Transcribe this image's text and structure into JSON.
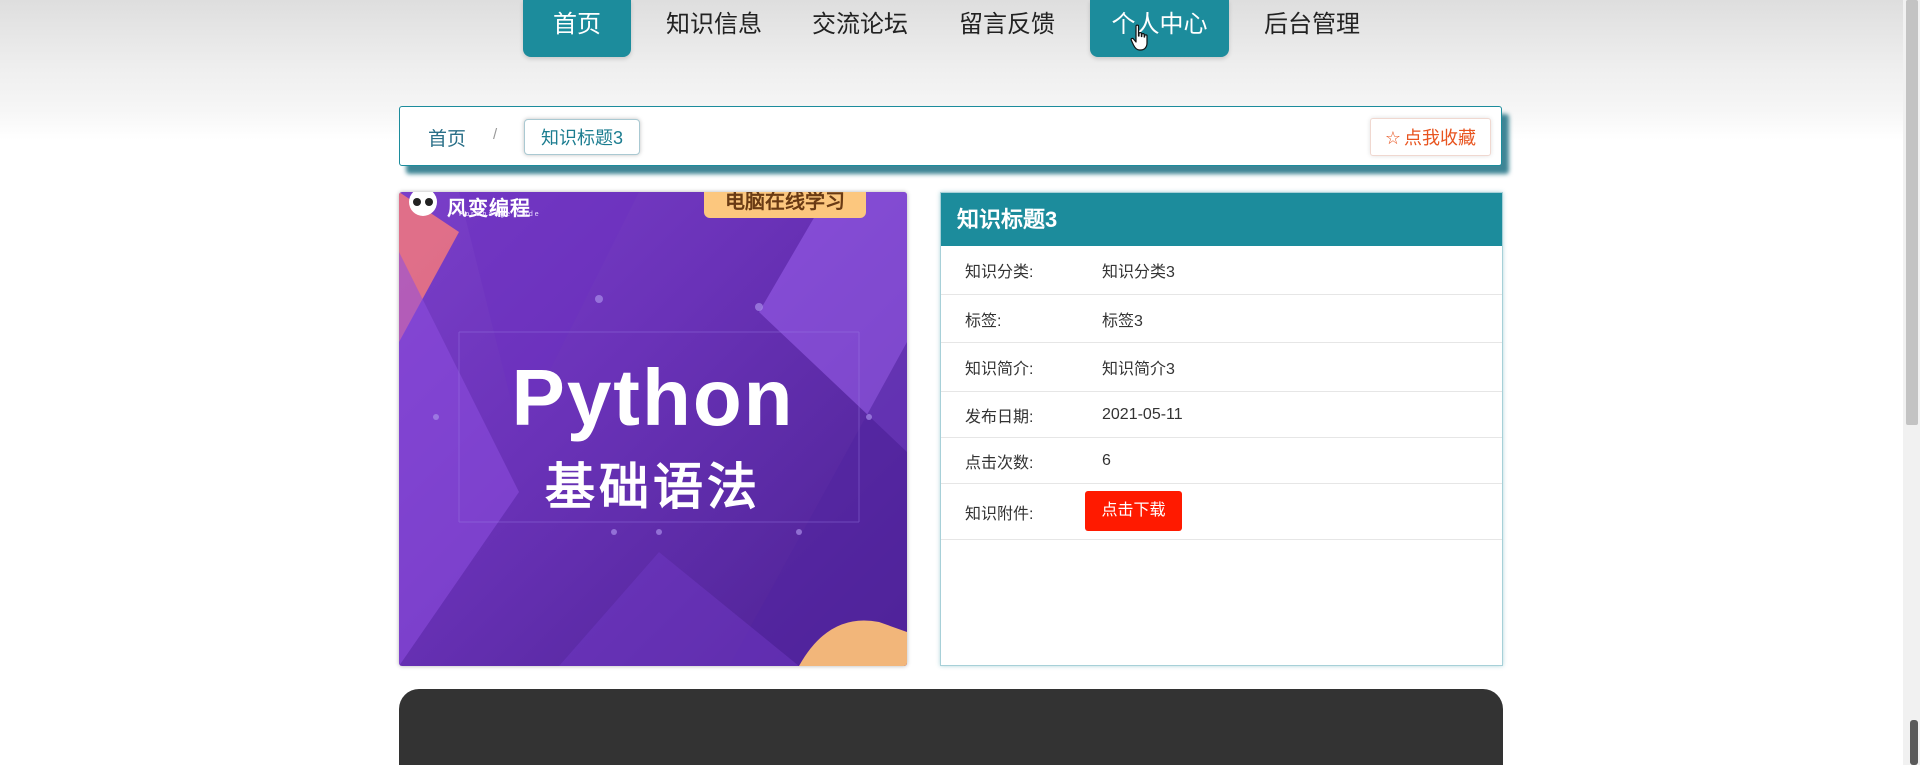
{
  "nav": {
    "items": [
      {
        "label": "首页",
        "active": true
      },
      {
        "label": "知识信息",
        "active": false
      },
      {
        "label": "交流论坛",
        "active": false
      },
      {
        "label": "留言反馈",
        "active": false
      },
      {
        "label": "个人中心",
        "active": true
      },
      {
        "label": "后台管理",
        "active": false
      }
    ]
  },
  "breadcrumb": {
    "home": "首页",
    "separator": "/",
    "current": "知识标题3"
  },
  "favorite": {
    "icon": "star-outline-icon",
    "label": "点我收藏"
  },
  "cover": {
    "logo_text": "风变编程",
    "logo_sub": "ForChange Code",
    "tag": "电脑在线学习",
    "title": "Python",
    "subtitle": "基础语法"
  },
  "detail": {
    "title": "知识标题3",
    "rows": [
      {
        "label": "知识分类:",
        "value": "知识分类3"
      },
      {
        "label": "标签:",
        "value": "标签3"
      },
      {
        "label": "知识简介:",
        "value": "知识简介3"
      },
      {
        "label": "发布日期:",
        "value": "2021-05-11"
      },
      {
        "label": "点击次数:",
        "value": "6"
      }
    ],
    "attachment_label": "知识附件:",
    "download_label": "点击下载"
  },
  "colors": {
    "primary": "#1c8c9c",
    "download": "#ff1a00",
    "favorite": "#e8541f",
    "footer": "#333333"
  }
}
